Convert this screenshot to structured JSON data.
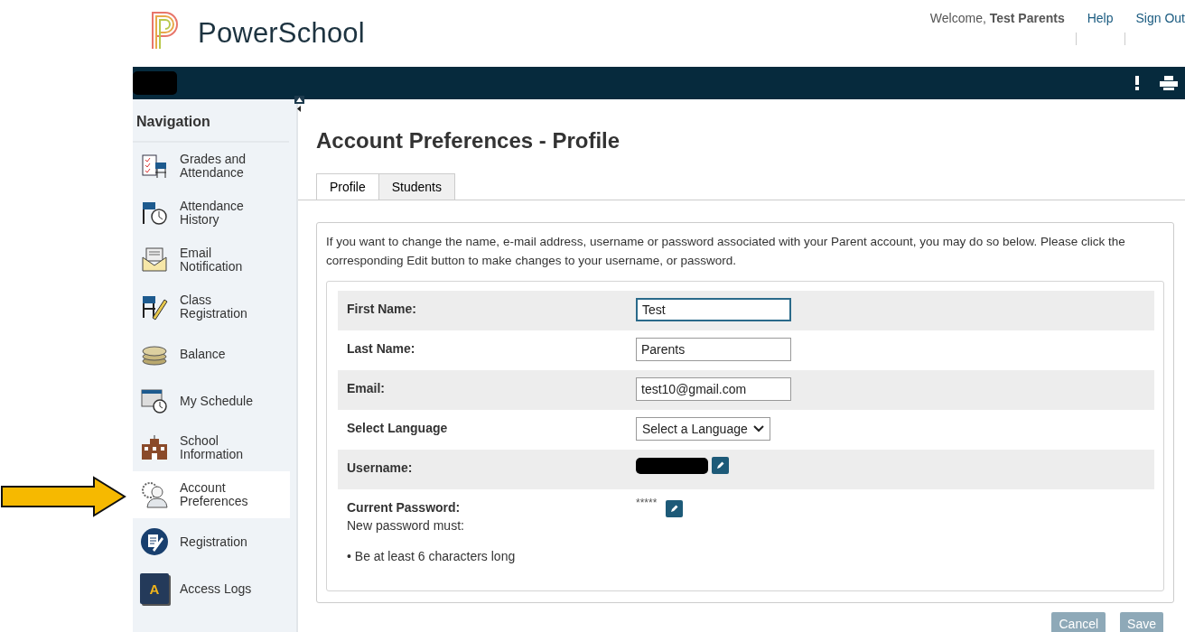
{
  "header": {
    "brand": "PowerSchool",
    "welcome": "Welcome,",
    "user": "Test Parents",
    "links": [
      "Help",
      "Sign Out"
    ]
  },
  "sidebar": {
    "title": "Navigation",
    "items": [
      {
        "label": "Grades and Attendance",
        "selected": false
      },
      {
        "label": "Attendance History",
        "selected": false
      },
      {
        "label": "Email Notification",
        "selected": false
      },
      {
        "label": "Class Registration",
        "selected": false
      },
      {
        "label": "Balance",
        "selected": false
      },
      {
        "label": "My Schedule",
        "selected": false
      },
      {
        "label": "School Information",
        "selected": false
      },
      {
        "label": "Account Preferences",
        "selected": true
      },
      {
        "label": "Registration",
        "selected": false
      },
      {
        "label": "Access Logs",
        "selected": false,
        "badge": "A"
      }
    ]
  },
  "page": {
    "title": "Account Preferences - Profile",
    "tabs": [
      {
        "label": "Profile",
        "selected": true
      },
      {
        "label": "Students",
        "selected": false
      }
    ],
    "intro": "If you want to change the name, e-mail address, username or password associated with your Parent account, you may do so below. Please click the corresponding Edit button to make changes to your username, or password.",
    "fields": [
      {
        "kind": "text",
        "label": "First Name:",
        "value": "Test",
        "focused": true
      },
      {
        "kind": "text",
        "label": "Last Name:",
        "value": "Parents",
        "focused": false
      },
      {
        "kind": "text",
        "label": "Email:",
        "value": "test10@gmail.com",
        "focused": false
      },
      {
        "kind": "select",
        "label": "Select Language",
        "value": "Select a Language"
      },
      {
        "kind": "redacted",
        "label": "Username:"
      },
      {
        "kind": "password",
        "label": "Current Password:",
        "value": "*****",
        "note": "New password must:",
        "rules": [
          "• Be at least 6 characters long"
        ]
      }
    ],
    "buttons": [
      {
        "label": "Cancel",
        "disabled": true
      },
      {
        "label": "Save",
        "disabled": true
      }
    ]
  }
}
